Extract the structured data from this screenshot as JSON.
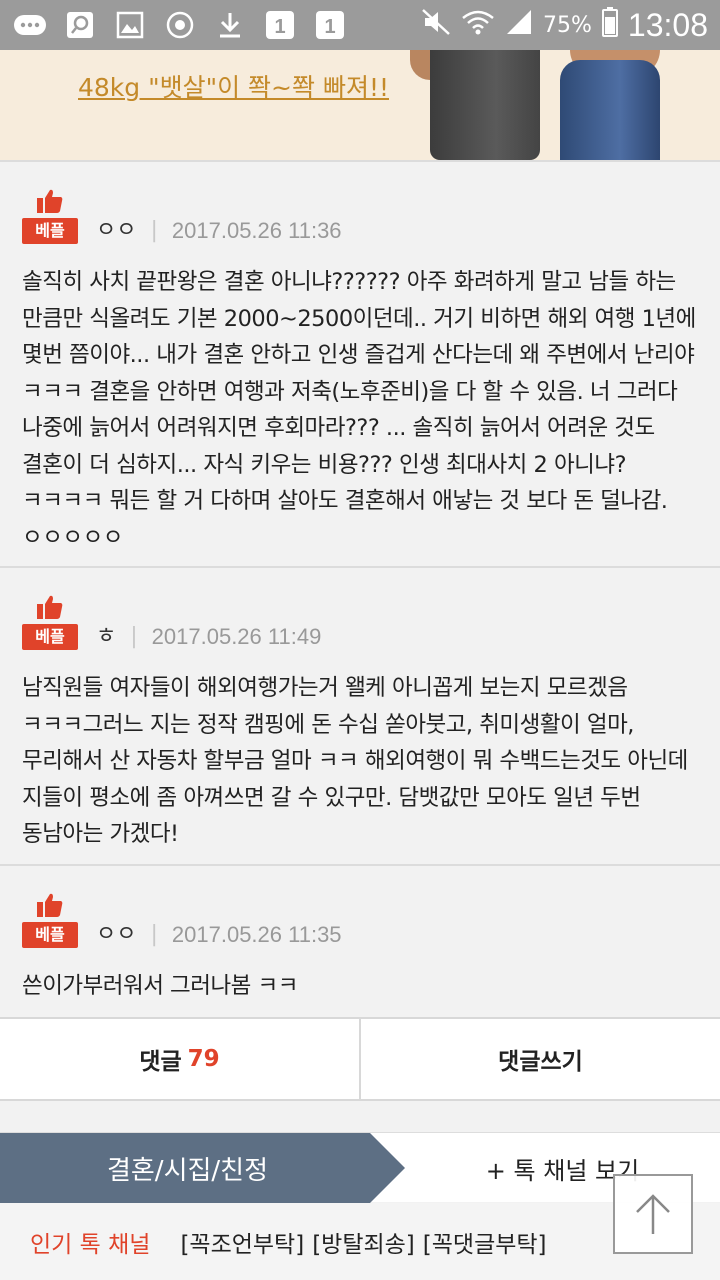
{
  "status_bar": {
    "battery": "75%",
    "time": "13:08"
  },
  "ad_banner": {
    "text": "48kg \"뱃살\"이 쫙~쫙 빠져!!"
  },
  "best_label": "베플",
  "comments": [
    {
      "author": "ㅇㅇ",
      "date": "2017.05.26 11:36",
      "body": "솔직히 사치 끝판왕은 결혼 아니냐?????? 아주 화려하게 말고 남들 하는 만큼만 식올려도 기본 2000~2500이던데.. 거기 비하면 해외 여행 1년에 몇번 쯤이야... 내가 결혼 안하고 인생 즐겁게 산다는데 왜 주변에서 난리야 ㅋㅋㅋ 결혼을 안하면 여행과 저축(노후준비)을 다 할 수 있음. 너 그러다 나중에 늙어서 어려워지면 후회마라??? ... 솔직히 늙어서 어려운 것도 결혼이 더 심하지... 자식 키우는 비용??? 인생 최대사치 2 아니냐?ㅋㅋㅋㅋ 뭐든 할 거 다하며 살아도 결혼해서 애낳는 것 보다 돈 덜나감. ㅇㅇㅇㅇㅇ"
    },
    {
      "author": "ㅎ",
      "date": "2017.05.26 11:49",
      "body": "남직원들 여자들이 해외여행가는거 왤케 아니꼽게 보는지 모르겠음 ㅋㅋㅋ그러느 지는 정작 캠핑에 돈 수십 쏟아붓고, 취미생활이 얼마, 무리해서 산 자동차 할부금 얼마 ㅋㅋ 해외여행이 뭐 수백드는것도 아닌데 지들이 평소에 좀 아껴쓰면 갈 수 있구만. 담뱃값만 모아도 일년 두번 동남아는 가겠다!"
    },
    {
      "author": "ㅇㅇ",
      "date": "2017.05.26 11:35",
      "body": "쓴이가부러워서 그러나봄 ㅋㅋ"
    }
  ],
  "actions": {
    "comments_label": "댓글",
    "comments_count": "79",
    "write_label": "댓글쓰기"
  },
  "channel": {
    "tag": "결혼/시집/친정",
    "view_label": "+ 톡 채널 보기"
  },
  "popular": {
    "label": "인기 톡 채널",
    "items": [
      "[꼭조언부탁]",
      "[방탈죄송]",
      "[꼭댓글부탁]"
    ]
  },
  "colors": {
    "accent": "#e0432a",
    "channel_tag": "#5d6f84",
    "status_bar": "#9b9b9b"
  }
}
